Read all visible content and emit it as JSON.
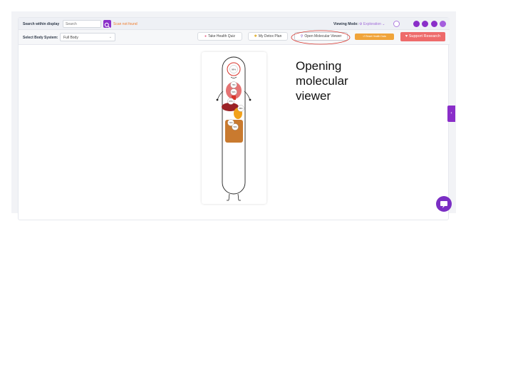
{
  "top_bar": {
    "search_label": "Search within display",
    "search_placeholder": "Search",
    "search_button_icon": "search-icon",
    "not_found_text": "Scan not found",
    "viewing_mode_label": "Viewing Mode:",
    "viewing_mode_value": "Exploration",
    "toolbar_icons": [
      "layers-icon",
      "brain-icon",
      "globe-icon",
      "link-icon",
      "more-icon"
    ],
    "colors": {
      "accent": "#8a2ec9",
      "warning": "#f07c2c"
    }
  },
  "second_bar": {
    "body_system_label": "Select Body System:",
    "body_system_value": "Full Body",
    "take_quiz": "Take Health Quiz",
    "detox_plan": "My Detox Plan",
    "open_molecular_viewer": "Open Molecular Viewer",
    "reset_health_data": "Reset Health Data",
    "support_research": "Support Research",
    "colors": {
      "reset": "#f0a43a",
      "support": "#ee6b6b",
      "highlight_ring": "#d9342b"
    }
  },
  "body_figure": {
    "labels": [
      "98%",
      "76%",
      "52%",
      "67%",
      "88%",
      "71%",
      "59%"
    ]
  },
  "annotation": {
    "lines": [
      "Opening",
      "molecular",
      "viewer"
    ]
  },
  "side_tab_icon": "chevron-left-icon",
  "chat_icon": "chat-icon"
}
